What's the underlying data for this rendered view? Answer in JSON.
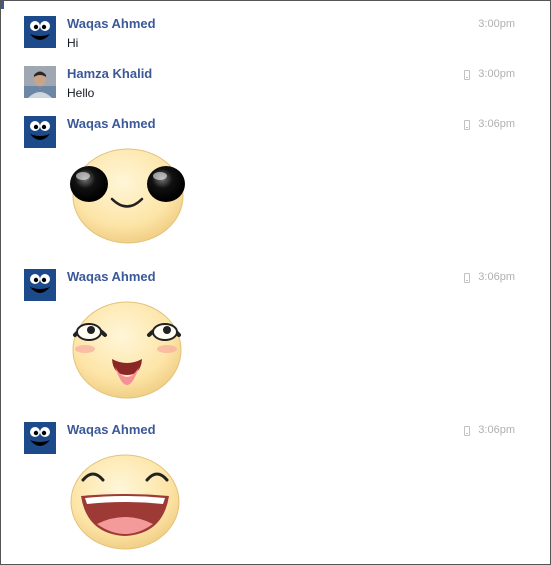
{
  "messages": [
    {
      "sender": "Waqas Ahmed",
      "avatar": "cookie-monster-avatar",
      "text": "Hi",
      "time": "3:00pm",
      "mobile": false
    },
    {
      "sender": "Hamza Khalid",
      "avatar": "person-photo-avatar",
      "text": "Hello",
      "time": "3:00pm",
      "mobile": true
    },
    {
      "sender": "Waqas Ahmed",
      "avatar": "cookie-monster-avatar",
      "sticker": "sunglasses-smiley-sticker",
      "time": "3:06pm",
      "mobile": true
    },
    {
      "sender": "Waqas Ahmed",
      "avatar": "cookie-monster-avatar",
      "sticker": "tongue-out-smiley-sticker",
      "time": "3:06pm",
      "mobile": true
    },
    {
      "sender": "Waqas Ahmed",
      "avatar": "cookie-monster-avatar",
      "sticker": "laughing-smiley-sticker",
      "time": "3:06pm",
      "mobile": true
    }
  ],
  "colors": {
    "name": "#3b5998",
    "time": "#b0b0b0",
    "cookie_blue": "#1d4a8a",
    "sticker_face": "#fce9b5"
  }
}
